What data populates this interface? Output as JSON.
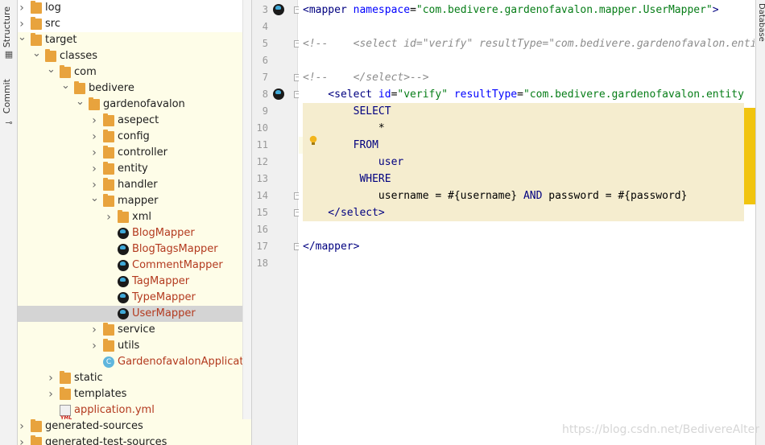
{
  "tool_strip": {
    "tabs": [
      {
        "label": "Structure"
      },
      {
        "label": "Commit"
      }
    ]
  },
  "right_strip": {
    "label": "Database"
  },
  "tree": {
    "items": [
      {
        "label": "log",
        "kind": "folder",
        "chevron": "right",
        "color": "normal"
      },
      {
        "label": "src",
        "kind": "folder",
        "chevron": "right",
        "color": "normal"
      },
      {
        "label": "target",
        "kind": "folder",
        "chevron": "down",
        "color": "normal"
      },
      {
        "label": "classes",
        "kind": "folder",
        "chevron": "down",
        "color": "normal"
      },
      {
        "label": "com",
        "kind": "folder",
        "chevron": "down",
        "color": "normal"
      },
      {
        "label": "bedivere",
        "kind": "folder",
        "chevron": "down",
        "color": "normal"
      },
      {
        "label": "gardenofavalon",
        "kind": "folder",
        "chevron": "down",
        "color": "normal"
      },
      {
        "label": "asepect",
        "kind": "folder",
        "chevron": "right",
        "color": "normal"
      },
      {
        "label": "config",
        "kind": "folder",
        "chevron": "right",
        "color": "normal"
      },
      {
        "label": "controller",
        "kind": "folder",
        "chevron": "right",
        "color": "normal"
      },
      {
        "label": "entity",
        "kind": "folder",
        "chevron": "right",
        "color": "normal"
      },
      {
        "label": "handler",
        "kind": "folder",
        "chevron": "right",
        "color": "normal"
      },
      {
        "label": "mapper",
        "kind": "folder",
        "chevron": "down",
        "color": "normal"
      },
      {
        "label": "xml",
        "kind": "folder",
        "chevron": "right",
        "color": "normal"
      },
      {
        "label": "BlogMapper",
        "kind": "mybatis",
        "chevron": "",
        "color": "red"
      },
      {
        "label": "BlogTagsMapper",
        "kind": "mybatis",
        "chevron": "",
        "color": "red"
      },
      {
        "label": "CommentMapper",
        "kind": "mybatis",
        "chevron": "",
        "color": "red"
      },
      {
        "label": "TagMapper",
        "kind": "mybatis",
        "chevron": "",
        "color": "red"
      },
      {
        "label": "TypeMapper",
        "kind": "mybatis",
        "chevron": "",
        "color": "red"
      },
      {
        "label": "UserMapper",
        "kind": "mybatis",
        "chevron": "",
        "color": "red",
        "selected": true
      },
      {
        "label": "service",
        "kind": "folder",
        "chevron": "right",
        "color": "normal"
      },
      {
        "label": "utils",
        "kind": "folder",
        "chevron": "right",
        "color": "normal"
      },
      {
        "label": "GardenofavalonApplication",
        "kind": "class",
        "chevron": "",
        "color": "red"
      },
      {
        "label": "static",
        "kind": "folder",
        "chevron": "right",
        "color": "normal"
      },
      {
        "label": "templates",
        "kind": "folder",
        "chevron": "right",
        "color": "normal"
      },
      {
        "label": "application.yml",
        "kind": "yml",
        "chevron": "",
        "color": "red"
      },
      {
        "label": "generated-sources",
        "kind": "folder",
        "chevron": "right",
        "color": "normal"
      },
      {
        "label": "generated-test-sources",
        "kind": "folder",
        "chevron": "right",
        "color": "normal"
      }
    ]
  },
  "editor": {
    "line_numbers": [
      "3",
      "4",
      "5",
      "6",
      "7",
      "8",
      "9",
      "10",
      "11",
      "12",
      "13",
      "14",
      "15",
      "16",
      "17",
      "18"
    ],
    "lines": [
      {
        "segs": [
          {
            "t": "<mapper ",
            "c": "tag"
          },
          {
            "t": "namespace",
            "c": "attr"
          },
          {
            "t": "=",
            "c": "plain"
          },
          {
            "t": "\"com.bedivere.gardenofavalon.mapper.UserMapper\"",
            "c": "str"
          },
          {
            "t": ">",
            "c": "tag"
          }
        ]
      },
      {
        "segs": []
      },
      {
        "segs": [
          {
            "t": "<!--    <select id=\"verify\" resultType=\"com.bedivere.gardenofavalon.enti",
            "c": "cmt"
          }
        ]
      },
      {
        "segs": []
      },
      {
        "segs": [
          {
            "t": "<!--    </select>-->",
            "c": "cmt"
          }
        ]
      },
      {
        "segs": [
          {
            "t": "    <select ",
            "c": "tag"
          },
          {
            "t": "id",
            "c": "attr"
          },
          {
            "t": "=",
            "c": "plain"
          },
          {
            "t": "\"verify\" ",
            "c": "str"
          },
          {
            "t": "resultType",
            "c": "attr"
          },
          {
            "t": "=",
            "c": "plain"
          },
          {
            "t": "\"com.bedivere.gardenofavalon.entity",
            "c": "str"
          }
        ]
      },
      {
        "segs": [
          {
            "t": "        SELECT",
            "c": "kw"
          }
        ]
      },
      {
        "segs": [
          {
            "t": "            *",
            "c": "plain"
          }
        ]
      },
      {
        "segs": [
          {
            "t": "        FROM",
            "c": "kw"
          }
        ]
      },
      {
        "segs": [
          {
            "t": "            user",
            "c": "kw"
          }
        ]
      },
      {
        "segs": [
          {
            "t": "         WHERE",
            "c": "kw"
          }
        ]
      },
      {
        "segs": [
          {
            "t": "            username = #{username} ",
            "c": "plain"
          },
          {
            "t": "AND",
            "c": "kw"
          },
          {
            "t": " password = #{password}",
            "c": "plain"
          }
        ]
      },
      {
        "segs": [
          {
            "t": "    </select>",
            "c": "tag"
          }
        ]
      },
      {
        "segs": []
      },
      {
        "segs": [
          {
            "t": "</mapper>",
            "c": "tag"
          }
        ]
      },
      {
        "segs": []
      }
    ]
  },
  "watermark": "https://blog.csdn.net/BedivereAlter"
}
